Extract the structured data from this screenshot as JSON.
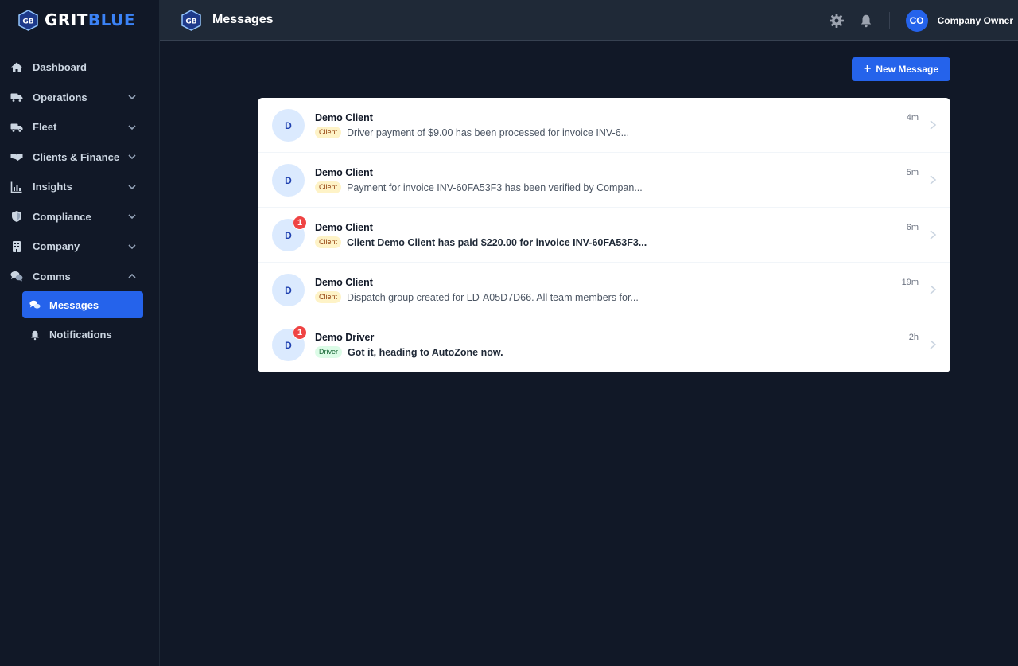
{
  "brand": {
    "badge": "{GB}",
    "name_part1": "GRIT",
    "name_part2": "BLUE"
  },
  "sidebar": {
    "items": [
      {
        "label": "Dashboard",
        "icon": "home-icon"
      },
      {
        "label": "Operations",
        "icon": "truck-icon"
      },
      {
        "label": "Fleet",
        "icon": "truck-icon"
      },
      {
        "label": "Clients & Finance",
        "icon": "handshake-icon"
      },
      {
        "label": "Insights",
        "icon": "chart-icon"
      },
      {
        "label": "Compliance",
        "icon": "shield-icon"
      },
      {
        "label": "Company",
        "icon": "building-icon"
      },
      {
        "label": "Comms",
        "icon": "chat-icon"
      }
    ],
    "comms_children": [
      {
        "label": "Messages",
        "icon": "chat-icon",
        "active": true
      },
      {
        "label": "Notifications",
        "icon": "bell-icon",
        "active": false
      }
    ]
  },
  "topbar": {
    "title": "Messages",
    "user_initials": "CO",
    "user_name": "Company Owner"
  },
  "new_message_label": "New Message",
  "messages": [
    {
      "initial": "D",
      "name": "Demo Client",
      "tag": "Client",
      "preview": "Driver payment of $9.00 has been processed for invoice INV-6...",
      "time": "4m",
      "unread": ""
    },
    {
      "initial": "D",
      "name": "Demo Client",
      "tag": "Client",
      "preview": "Payment for invoice INV-60FA53F3 has been verified by Compan...",
      "time": "5m",
      "unread": ""
    },
    {
      "initial": "D",
      "name": "Demo Client",
      "tag": "Client",
      "preview": "Client Demo Client has paid $220.00 for invoice INV-60FA53F3...",
      "time": "6m",
      "unread": "1"
    },
    {
      "initial": "D",
      "name": "Demo Client",
      "tag": "Client",
      "preview": "Dispatch group created for LD-A05D7D66. All team members for...",
      "time": "19m",
      "unread": ""
    },
    {
      "initial": "D",
      "name": "Demo Driver",
      "tag": "Driver",
      "preview": "Got it, heading to AutoZone now.",
      "time": "2h",
      "unread": "1"
    }
  ],
  "colors": {
    "accent": "#2563eb",
    "background": "#111827",
    "unread": "#ef4444"
  }
}
